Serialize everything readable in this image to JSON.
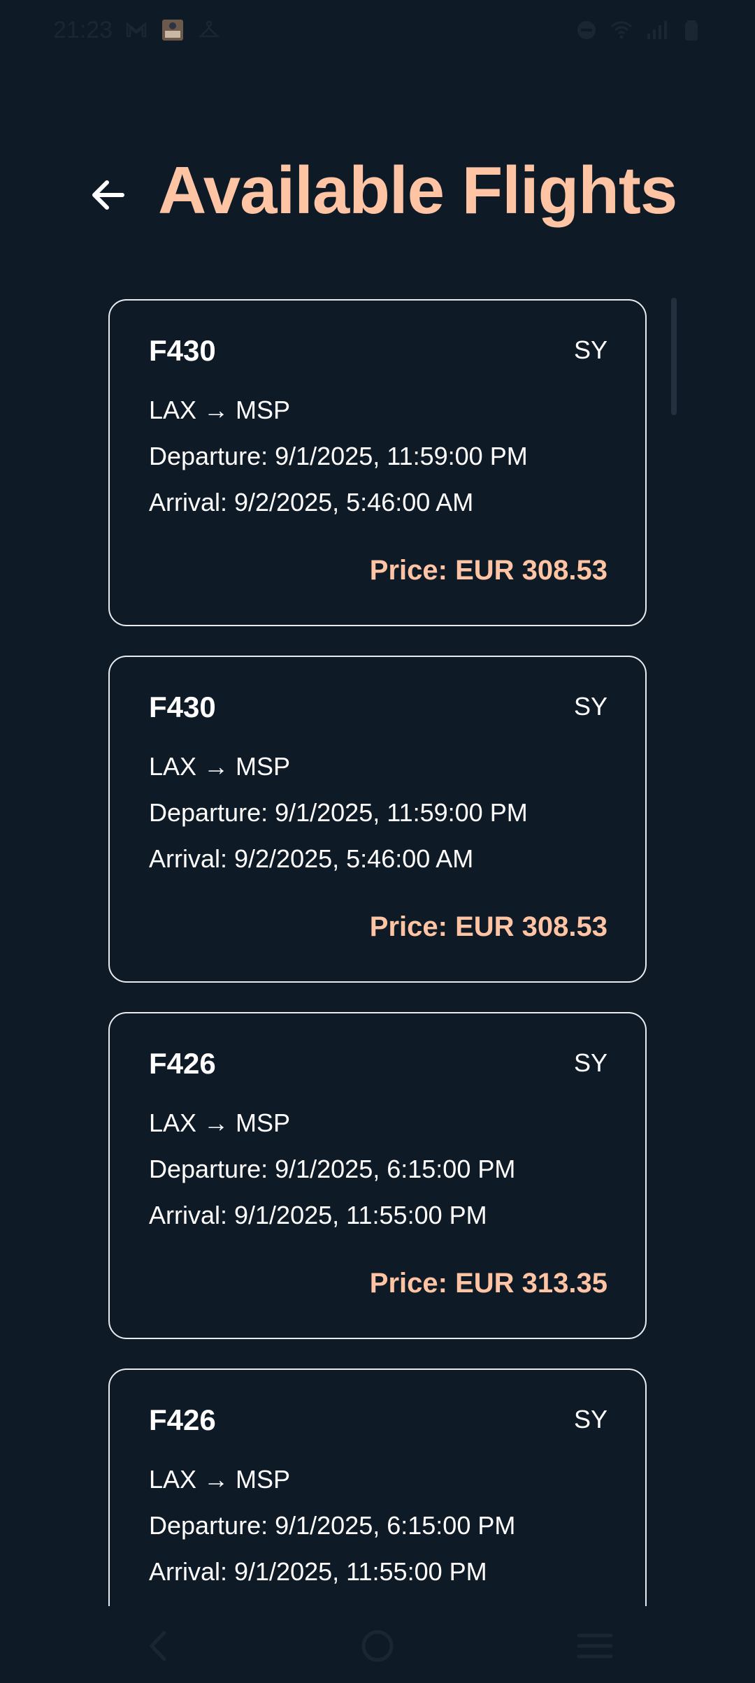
{
  "status_bar": {
    "time": "21:23",
    "left_icons": [
      "mail-icon",
      "photo-thumbnail-icon",
      "hanger-icon"
    ],
    "right_icons": [
      "dnd-icon",
      "wifi-icon",
      "signal-icon",
      "battery-icon"
    ]
  },
  "header": {
    "title": "Available Flights",
    "back_icon": "arrow-left-icon"
  },
  "flights": [
    {
      "number": "F430",
      "airline": "SY",
      "route": "LAX → MSP",
      "departure": "Departure: 9/1/2025, 11:59:00 PM",
      "arrival": "Arrival: 9/2/2025, 5:46:00 AM",
      "price": "Price: EUR 308.53"
    },
    {
      "number": "F430",
      "airline": "SY",
      "route": "LAX → MSP",
      "departure": "Departure: 9/1/2025, 11:59:00 PM",
      "arrival": "Arrival: 9/2/2025, 5:46:00 AM",
      "price": "Price: EUR 308.53"
    },
    {
      "number": "F426",
      "airline": "SY",
      "route": "LAX → MSP",
      "departure": "Departure: 9/1/2025, 6:15:00 PM",
      "arrival": "Arrival: 9/1/2025, 11:55:00 PM",
      "price": "Price: EUR 313.35"
    },
    {
      "number": "F426",
      "airline": "SY",
      "route": "LAX → MSP",
      "departure": "Departure: 9/1/2025, 6:15:00 PM",
      "arrival": "Arrival: 9/1/2025, 11:55:00 PM",
      "price": ""
    }
  ],
  "nav_bar": {
    "icons": [
      "nav-back-icon",
      "nav-home-icon",
      "nav-recents-icon"
    ]
  },
  "colors": {
    "background": "#0f1a27",
    "accent": "#ffc4a3",
    "card_border": "#e9ecef",
    "text": "#ffffff"
  }
}
